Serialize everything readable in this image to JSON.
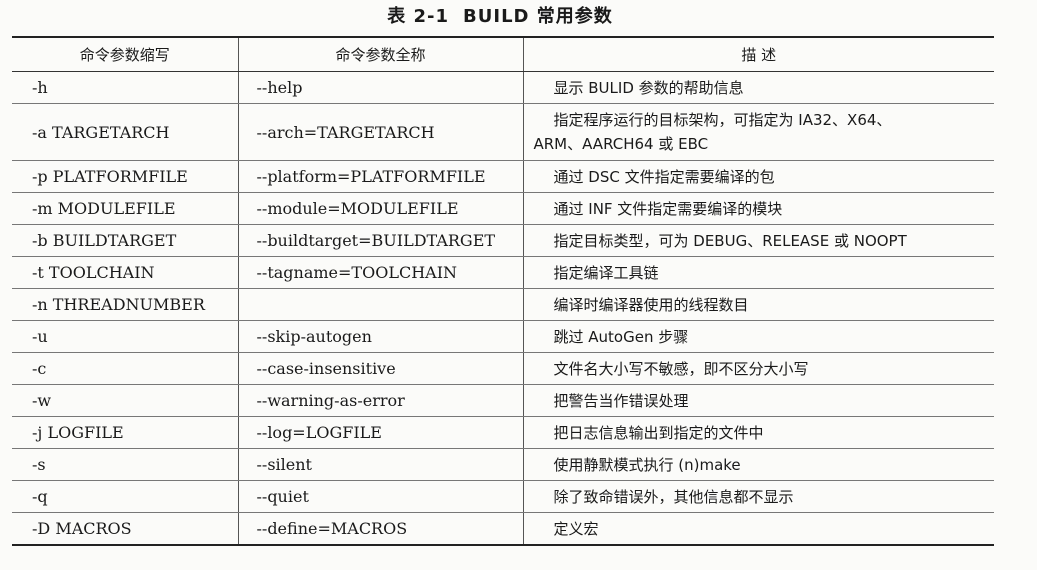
{
  "caption": {
    "number": "表 2-1",
    "title": "BUILD 常用参数"
  },
  "headers": {
    "short": "命令参数缩写",
    "full": "命令参数全称",
    "desc": "描  述"
  },
  "rows": [
    {
      "short": "-h",
      "full": "--help",
      "desc": "显示 BULID 参数的帮助信息"
    },
    {
      "short": "-a TARGETARCH",
      "full": "--arch=TARGETARCH",
      "desc": "指定程序运行的目标架构，可指定为 IA32、X64、",
      "desc_cont": "ARM、AARCH64 或 EBC"
    },
    {
      "short": "-p PLATFORMFILE",
      "full": "--platform=PLATFORMFILE",
      "desc": "通过 DSC 文件指定需要编译的包"
    },
    {
      "short": "-m MODULEFILE",
      "full": "--module=MODULEFILE",
      "desc": "通过 INF 文件指定需要编译的模块"
    },
    {
      "short": "-b BUILDTARGET",
      "full": "--buildtarget=BUILDTARGET",
      "desc": "指定目标类型，可为 DEBUG、RELEASE 或 NOOPT"
    },
    {
      "short": "-t TOOLCHAIN",
      "full": "--tagname=TOOLCHAIN",
      "desc": "指定编译工具链"
    },
    {
      "short": "-n THREADNUMBER",
      "full": "",
      "desc": "编译时编译器使用的线程数目"
    },
    {
      "short": "-u",
      "full": "--skip-autogen",
      "desc": "跳过 AutoGen 步骤"
    },
    {
      "short": "-c",
      "full": "--case-insensitive",
      "desc": "文件名大小写不敏感，即不区分大小写"
    },
    {
      "short": "-w",
      "full": "--warning-as-error",
      "desc": "把警告当作错误处理"
    },
    {
      "short": "-j LOGFILE",
      "full": "--log=LOGFILE",
      "desc": "把日志信息输出到指定的文件中"
    },
    {
      "short": "-s",
      "full": "--silent",
      "desc": "使用静默模式执行 (n)make"
    },
    {
      "short": "-q",
      "full": "--quiet",
      "desc": "除了致命错误外，其他信息都不显示"
    },
    {
      "short": "-D MACROS",
      "full": "--define=MACROS",
      "desc": "定义宏"
    }
  ]
}
